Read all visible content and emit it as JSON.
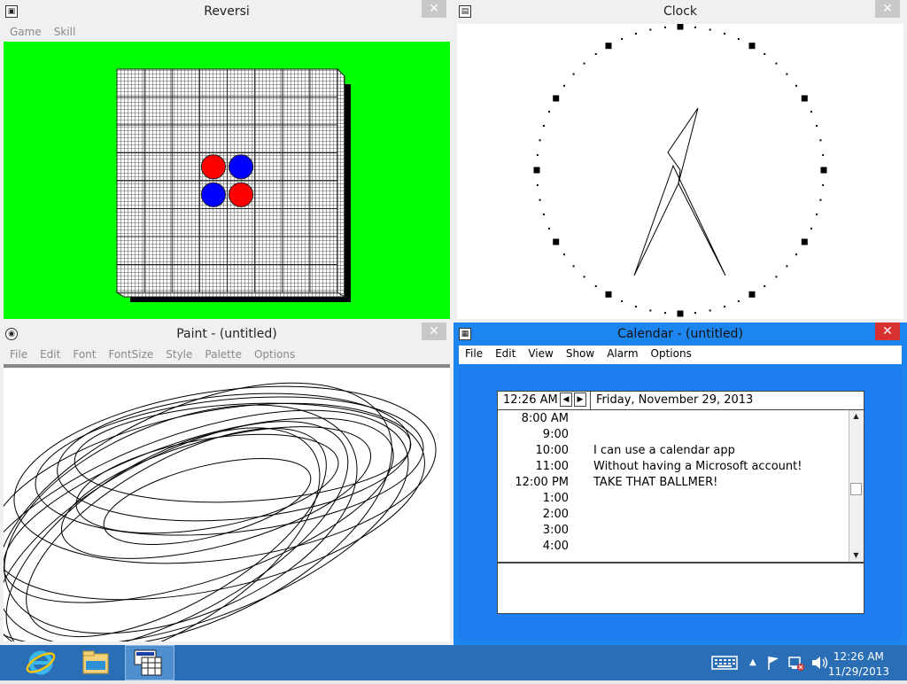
{
  "reversi": {
    "title": "Reversi",
    "menu": [
      "Game",
      "Skill"
    ],
    "pieces": [
      {
        "row": 3,
        "col": 3,
        "color": "red"
      },
      {
        "row": 3,
        "col": 4,
        "color": "blue"
      },
      {
        "row": 4,
        "col": 3,
        "color": "blue"
      },
      {
        "row": 4,
        "col": 4,
        "color": "red"
      }
    ],
    "colors": {
      "background": "#00ff00",
      "red": "#ff0000",
      "blue": "#0000ff"
    }
  },
  "clock": {
    "title": "Clock",
    "time": "12:26"
  },
  "paint": {
    "title": "Paint - (untitled)",
    "menu": [
      "File",
      "Edit",
      "Font",
      "FontSize",
      "Style",
      "Palette",
      "Options"
    ]
  },
  "calendar": {
    "title": "Calendar - (untitled)",
    "menu": [
      "File",
      "Edit",
      "View",
      "Show",
      "Alarm",
      "Options"
    ],
    "current_time": "12:26 AM",
    "date": "Friday, November 29, 2013",
    "slots": [
      {
        "time": "8:00 AM",
        "text": ""
      },
      {
        "time": "9:00",
        "text": ""
      },
      {
        "time": "10:00",
        "text": "I can use a calendar app"
      },
      {
        "time": "11:00",
        "text": "Without having a Microsoft account!"
      },
      {
        "time": "12:00 PM",
        "text": "TAKE THAT BALLMER!"
      },
      {
        "time": "1:00",
        "text": ""
      },
      {
        "time": "2:00",
        "text": ""
      },
      {
        "time": "3:00",
        "text": ""
      },
      {
        "time": "4:00",
        "text": ""
      }
    ]
  },
  "taskbar": {
    "time": "12:26 AM",
    "date": "11/29/2013",
    "pinned": [
      "internet-explorer-icon",
      "file-explorer-icon",
      "windows-app-icon"
    ],
    "tray": [
      "keyboard-icon",
      "show-hidden-icons",
      "action-center-flag-icon",
      "network-icon",
      "volume-icon"
    ]
  }
}
